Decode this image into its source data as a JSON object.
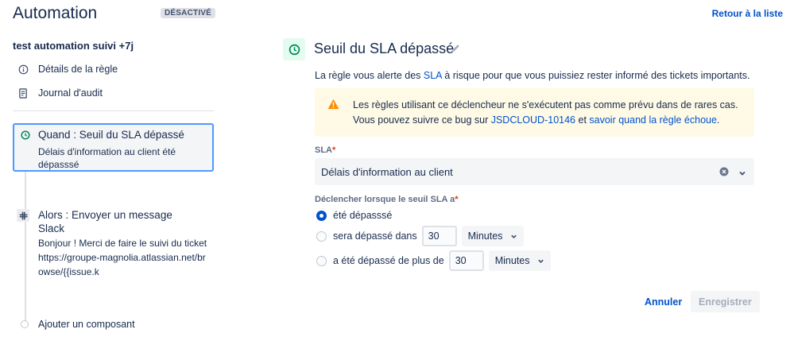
{
  "header": {
    "title": "Automation",
    "status_badge": "DÉSACTIVÉ",
    "back_link": "Retour à la liste"
  },
  "sidebar": {
    "rule_name": "test automation suivi +7j",
    "links": [
      {
        "label": "Détails de la règle",
        "icon": "info-icon"
      },
      {
        "label": "Journal d'audit",
        "icon": "document-icon"
      }
    ],
    "trigger": {
      "title": "Quand : Seuil du SLA dépassé",
      "description": "Délais d'information au client été dépasssé",
      "icon": "clock-icon"
    },
    "action": {
      "title": "Alors : Envoyer un message Slack",
      "description": "Bonjour ! Merci de faire le suivi du ticket https://groupe-magnolia.atlassian.net/browse/{{issue.k",
      "icon": "slack-icon"
    },
    "add_component": "Ajouter un composant"
  },
  "main": {
    "title": "Seuil du SLA dépassé",
    "intro": {
      "before": "La règle vous alerte des ",
      "link": "SLA",
      "after": " à risque pour que vous puissiez rester informé des tickets importants."
    },
    "warning": {
      "text1": "Les règles utilisant ce déclencheur ne s'exécutent pas comme prévu dans de rares cas. Vous pouvez suivre ce bug sur ",
      "link1": "JSDCLOUD-10146",
      "text2": " et ",
      "link2": "savoir quand la règle échoue",
      "text3": "."
    },
    "sla_field": {
      "label": "SLA",
      "required_mark": "*",
      "value": "Délais d'information au client"
    },
    "threshold_field": {
      "label": "Déclencher lorsque le seuil SLA a",
      "required_mark": "*",
      "options": [
        {
          "label": "été dépasssé",
          "checked": true
        },
        {
          "label": "sera dépassé dans",
          "checked": false,
          "value": "30",
          "unit": "Minutes"
        },
        {
          "label": "a été dépassé de plus de",
          "checked": false,
          "value": "30",
          "unit": "Minutes"
        }
      ]
    },
    "buttons": {
      "cancel": "Annuler",
      "save": "Enregistrer"
    }
  },
  "colors": {
    "primary": "#0052cc",
    "trigger_border": "#4c9aff",
    "warning_bg": "#fffae6",
    "warning_icon": "#ff8b00",
    "success": "#00875a"
  }
}
